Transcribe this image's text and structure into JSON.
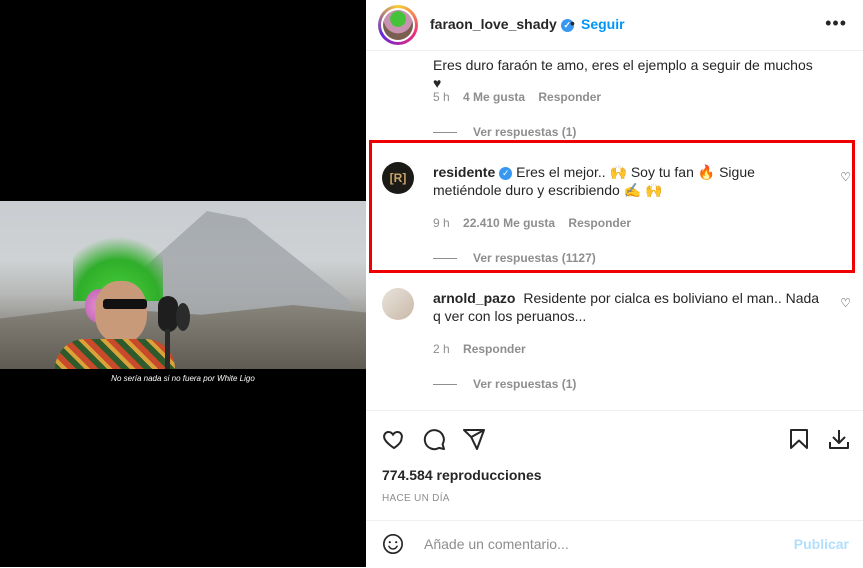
{
  "video": {
    "subtitle": "No sería nada si no fuera por White Ligo"
  },
  "header": {
    "username": "faraon_love_shady",
    "verified_icon": "verified-badge-icon",
    "separator": "•",
    "follow_label": "Seguir",
    "more_icon": "more-horizontal-icon"
  },
  "comments": [
    {
      "username": "",
      "text": "Eres duro faraón te amo, eres el ejemplo a seguir de muchos ♥",
      "time": "5 h",
      "likes": "4 Me gusta",
      "reply": "Responder",
      "view_replies": "Ver respuestas (1)"
    },
    {
      "username": "residente",
      "text": "Eres el mejor.. 🙌 Soy tu fan 🔥 Sigue metiéndole duro y escribiendo ✍️ 🙌",
      "time": "9 h",
      "likes": "22.410 Me gusta",
      "reply": "Responder",
      "view_replies": "Ver respuestas (1127)",
      "highlight_color": "#e00000"
    },
    {
      "username": "arnold_pazo",
      "text": "Residente por cialca es boliviano el man.. Nada q ver con los peruanos...",
      "time": "2 h",
      "reply": "Responder",
      "view_replies": "Ver respuestas (1)"
    }
  ],
  "actions": {
    "like_icon": "heart-icon",
    "comment_icon": "comment-icon",
    "share_icon": "share-icon",
    "save_icon": "bookmark-icon",
    "download_icon": "download-icon",
    "views": "774.584 reproducciones",
    "time": "HACE UN DÍA"
  },
  "composer": {
    "placeholder": "Añade un comentario...",
    "publish_label": "Publicar"
  },
  "colors": {
    "accent": "#0095f6",
    "publish_disabled": "#b2dffc",
    "highlight": "#e00000"
  }
}
